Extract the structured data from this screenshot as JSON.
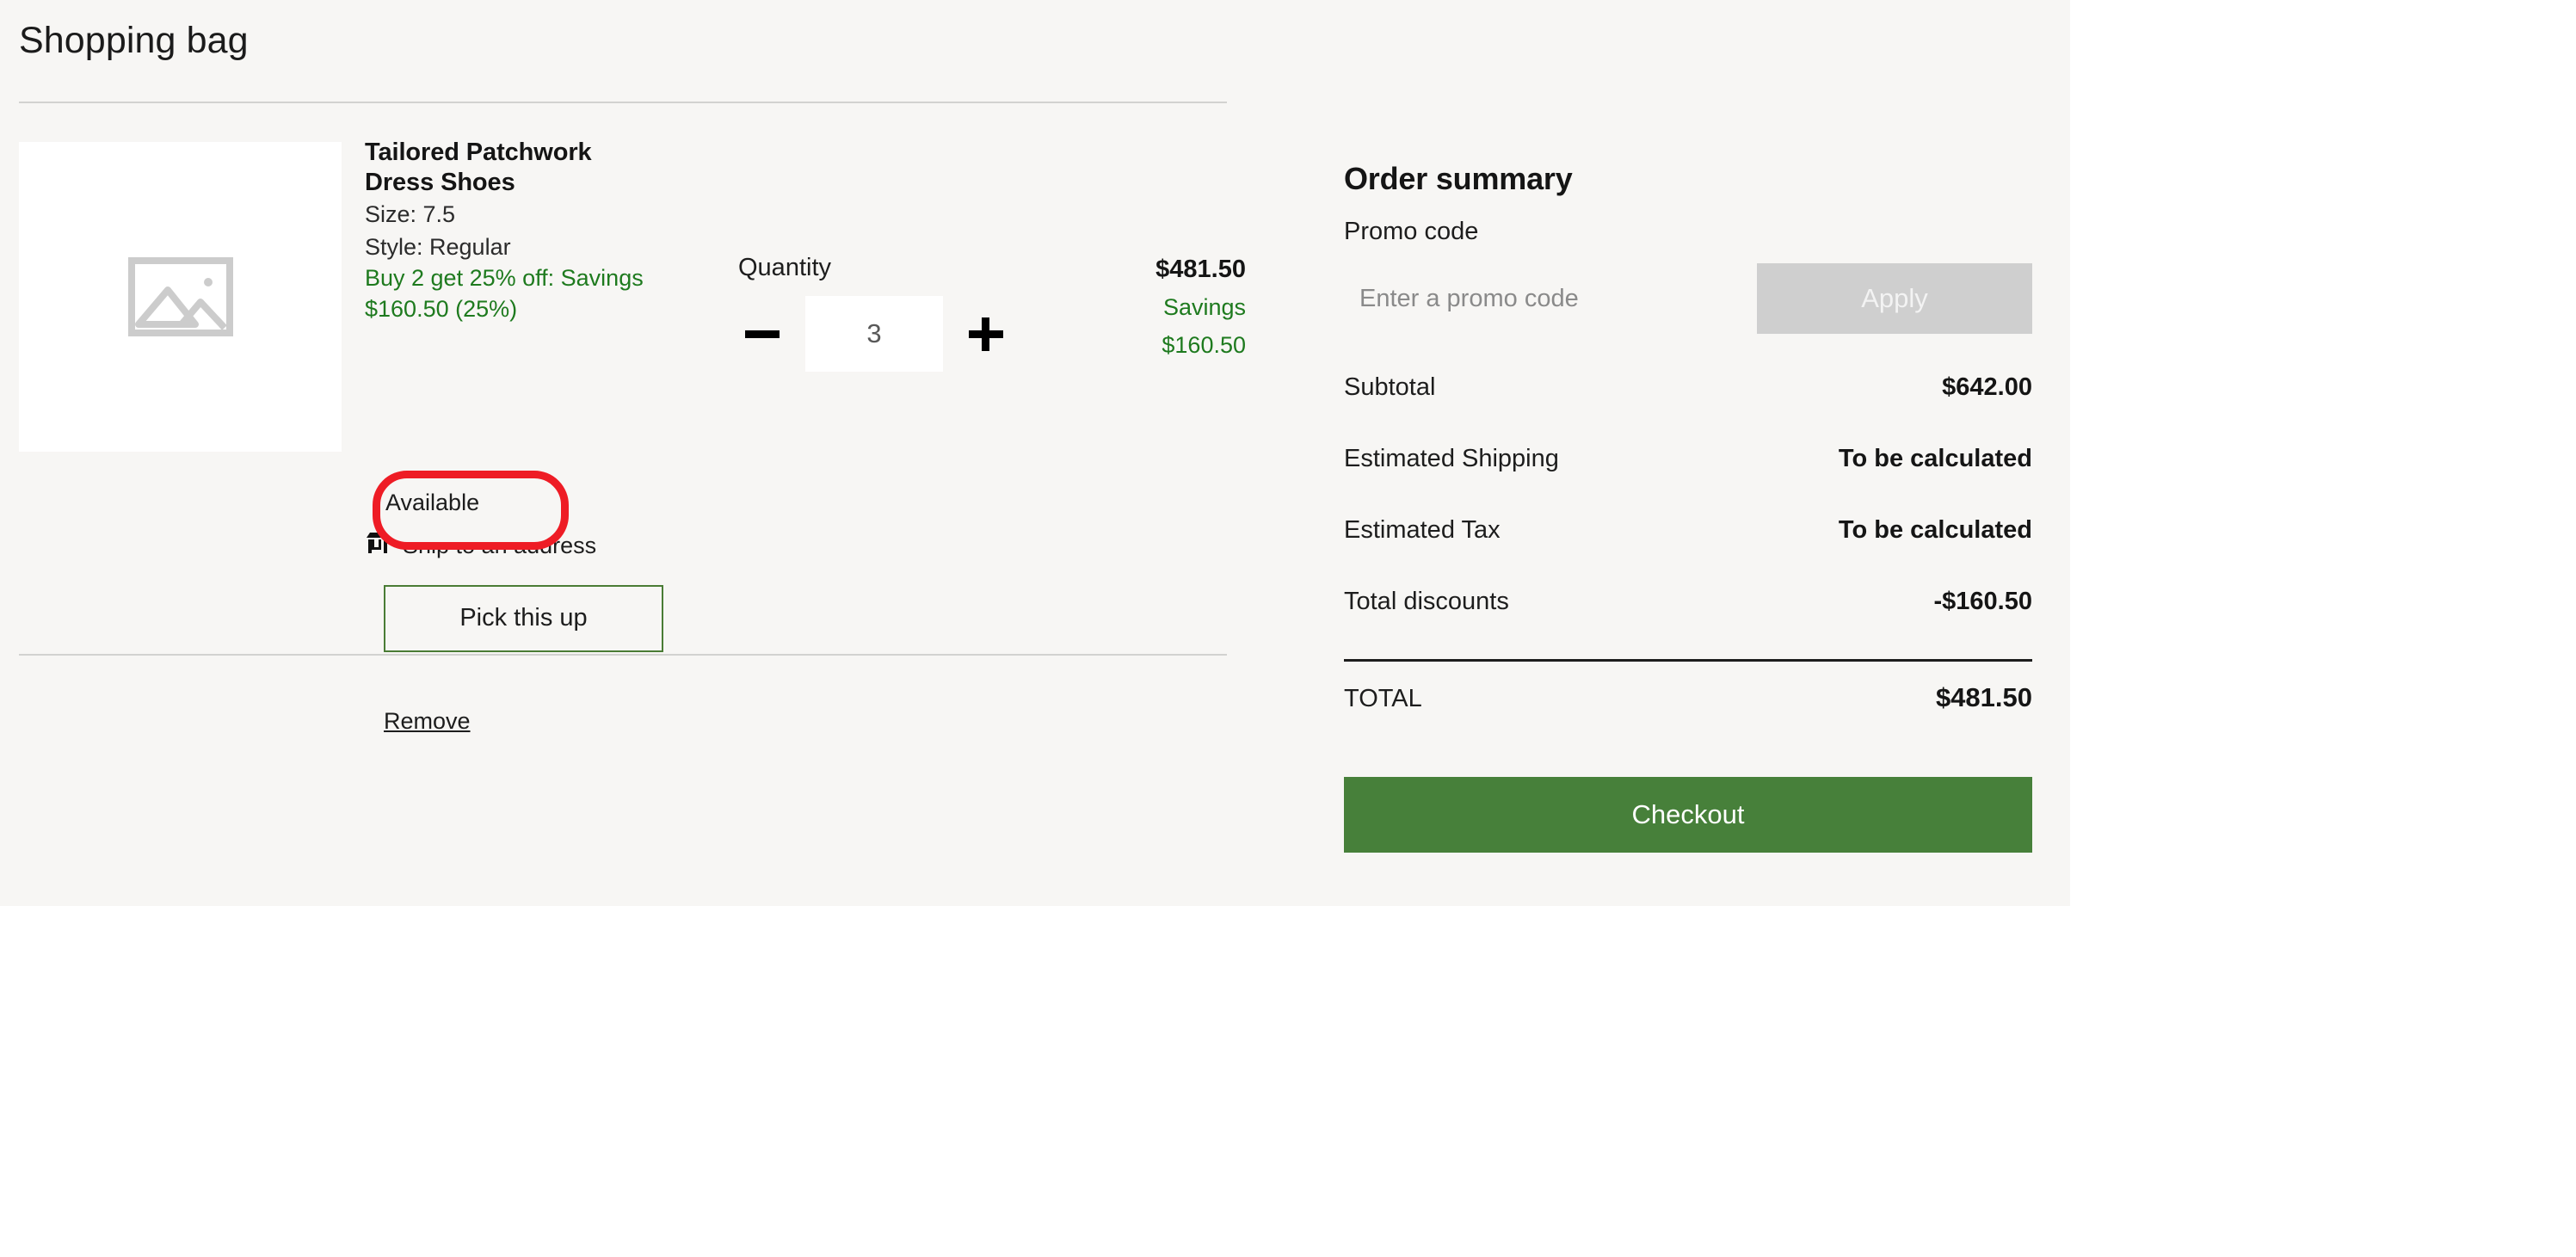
{
  "bag": {
    "title": "Shopping bag",
    "item": {
      "thumbnail_icon": "image-placeholder-icon",
      "name": "Tailored Patchwork Dress Shoes",
      "size": "Size: 7.5",
      "style": "Style: Regular",
      "promotion": "Buy 2 get 25% off: Savings $160.50 (25%)",
      "availability": "Available",
      "fulfillment_icon": "storefront-icon",
      "fulfillment_label": "Ship to an address",
      "pickup_button": "Pick this up",
      "remove_link": "Remove",
      "quantity_label": "Quantity",
      "quantity_value": "3",
      "decrement_icon": "minus-icon",
      "increment_icon": "plus-icon",
      "price": "$481.50",
      "savings_label": "Savings",
      "savings_amount": "$160.50"
    }
  },
  "summary": {
    "title": "Order summary",
    "promo_label": "Promo code",
    "promo_placeholder": "Enter a promo code",
    "promo_value": "",
    "apply_label": "Apply",
    "rows": [
      {
        "label": "Subtotal",
        "value": "$642.00"
      },
      {
        "label": "Estimated Shipping",
        "value": "To be calculated"
      },
      {
        "label": "Estimated Tax",
        "value": "To be calculated"
      },
      {
        "label": "Total discounts",
        "value": "-$160.50"
      }
    ],
    "total_label": "TOTAL",
    "total_value": "$481.50",
    "checkout_label": "Checkout"
  },
  "colors": {
    "page_background": "#f7f6f4",
    "savings_green": "#1e7a1e",
    "checkout_green": "#47803a",
    "pickup_border_green": "#4a7c35",
    "apply_disabled": "#cfcfcf",
    "annotation_red": "#ee1c25"
  }
}
